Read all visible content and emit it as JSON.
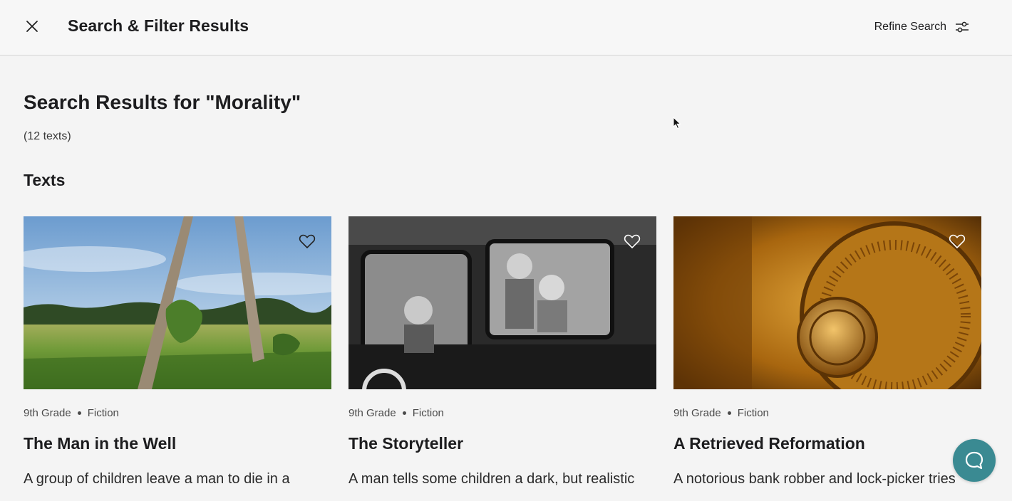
{
  "header": {
    "close_icon": "close-icon",
    "title": "Search & Filter Results",
    "refine_label": "Refine Search",
    "refine_icon": "sliders-icon"
  },
  "results": {
    "heading": "Search Results for \"Morality\"",
    "count": "(12 texts)"
  },
  "section": {
    "title": "Texts"
  },
  "cards": [
    {
      "image": "field-with-dead-trees-photo",
      "grade": "9th Grade",
      "genre": "Fiction",
      "title": "The Man in the Well",
      "description": "A group of children leave a man to die in a",
      "favorite_icon": "heart-outline-icon"
    },
    {
      "image": "children-in-bus-window-photo",
      "grade": "9th Grade",
      "genre": "Fiction",
      "title": "The Storyteller",
      "description": "A man tells some children a dark, but realistic",
      "favorite_icon": "heart-outline-icon"
    },
    {
      "image": "safe-combination-dial-photo",
      "grade": "9th Grade",
      "genre": "Fiction",
      "title": "A Retrieved Reformation",
      "description": "A notorious bank robber and lock-picker tries",
      "favorite_icon": "heart-outline-icon"
    }
  ],
  "help_button": {
    "icon": "chat-bubble-icon",
    "color": "#3a8a92"
  }
}
